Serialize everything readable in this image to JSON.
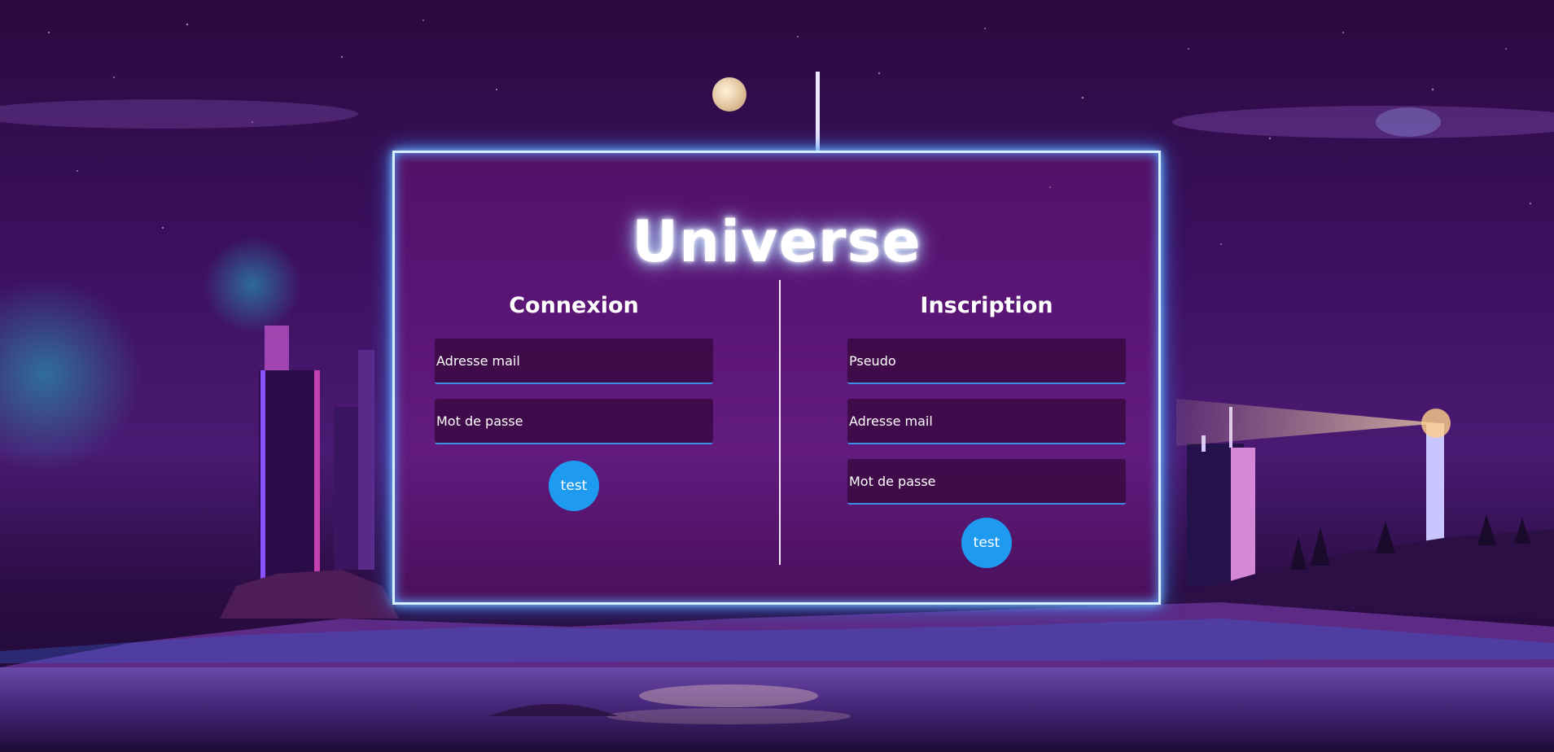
{
  "app": {
    "title": "Universe"
  },
  "login": {
    "heading": "Connexion",
    "email_placeholder": "Adresse mail",
    "password_placeholder": "Mot de passe",
    "submit_label": "test"
  },
  "signup": {
    "heading": "Inscription",
    "username_placeholder": "Pseudo",
    "email_placeholder": "Adresse mail",
    "password_placeholder": "Mot de passe",
    "submit_label": "test"
  },
  "colors": {
    "neon_border": "#d9eeff",
    "button": "#1e9bf0",
    "field_underline": "#3b8fe6"
  }
}
